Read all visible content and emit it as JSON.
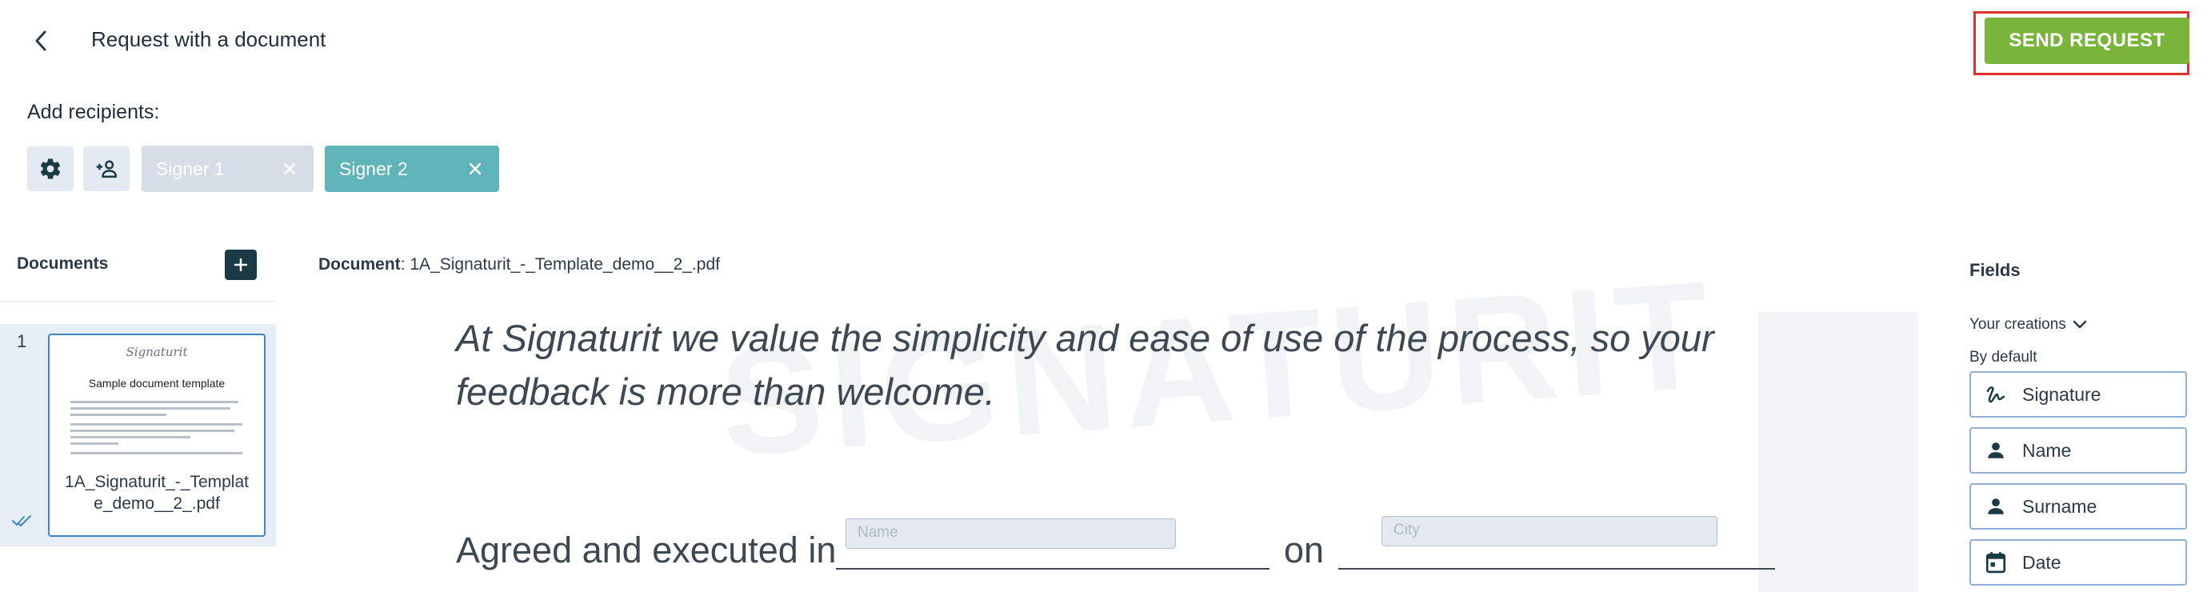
{
  "header": {
    "title": "Request with a document",
    "send_button": "SEND REQUEST",
    "accent_color": "#7ab53b",
    "highlight_color": "#e0312d"
  },
  "recipients": {
    "label": "Add recipients:",
    "signers": [
      {
        "label": "Signer 1",
        "color": "#d7dde6"
      },
      {
        "label": "Signer 2",
        "color": "#5fb4b9"
      }
    ]
  },
  "documents": {
    "label": "Documents",
    "items": [
      {
        "index": "1",
        "thumb_logo": "Signaturit",
        "thumb_title": "Sample document template",
        "name": "1A_Signaturit_-_Template_demo__2_.pdf"
      }
    ]
  },
  "document_view": {
    "caption_label": "Document",
    "caption_file": ": 1A_Signaturit_-_Template_demo__2_.pdf",
    "paragraph": "At Signaturit we value the simplicity and ease of use of the process, so your feedback is more than welcome.",
    "agreed_text": "Agreed and executed in",
    "on_text": "on",
    "name_field_placeholder": "Name",
    "city_field_placeholder": "City"
  },
  "fields": {
    "title": "Fields",
    "your_creations": "Your creations",
    "by_default": "By default",
    "items": [
      {
        "label": "Signature",
        "icon": "signature-icon"
      },
      {
        "label": "Name",
        "icon": "person-icon"
      },
      {
        "label": "Surname",
        "icon": "person-icon"
      },
      {
        "label": "Date",
        "icon": "calendar-icon"
      }
    ]
  }
}
